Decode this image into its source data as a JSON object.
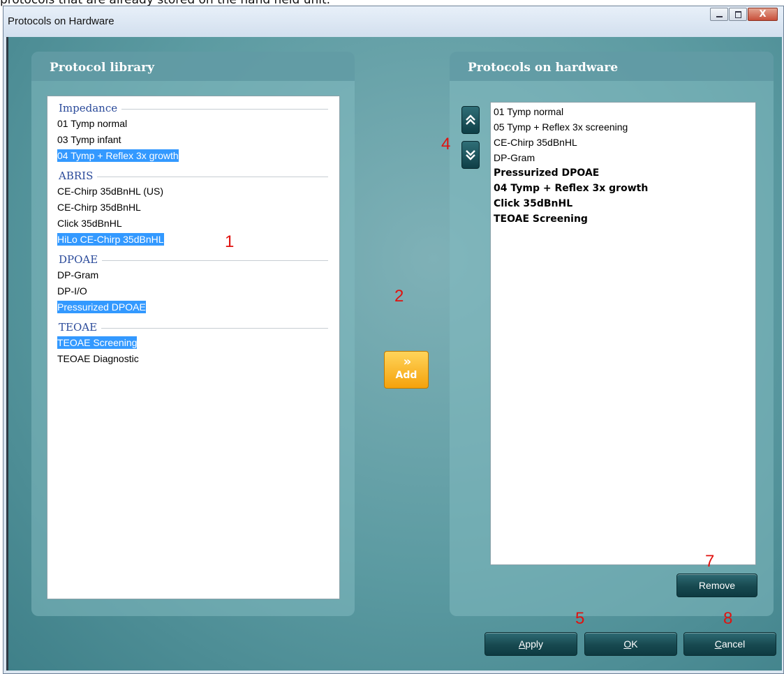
{
  "caption_text": "protocols that are already stored on the hand held unit.",
  "window": {
    "title": "Protocols on Hardware",
    "minimize_icon": "minimize-icon",
    "maximize_icon": "maximize-icon",
    "close_glyph": "X"
  },
  "library": {
    "title": "Protocol library",
    "groups": [
      {
        "label": "Impedance",
        "items": [
          "01 Tymp normal",
          "03 Tymp infant",
          "04 Tymp + Reflex 3x growth"
        ]
      },
      {
        "label": "ABRIS",
        "items": [
          "CE-Chirp 35dBnHL (US)",
          "CE-Chirp 35dBnHL",
          "Click 35dBnHL",
          "HiLo CE-Chirp 35dBnHL"
        ]
      },
      {
        "label": "DPOAE",
        "items": [
          "DP-Gram",
          "DP-I/O",
          "Pressurized DPOAE"
        ]
      },
      {
        "label": "TEOAE",
        "items": [
          "TEOAE Screening",
          "TEOAE Diagnostic"
        ]
      }
    ],
    "selected_items": [
      "04 Tymp + Reflex 3x growth",
      "HiLo CE-Chirp 35dBnHL",
      "Pressurized DPOAE",
      "TEOAE Screening"
    ]
  },
  "hardware": {
    "title": "Protocols on hardware",
    "items": [
      {
        "label": "01 Tymp normal",
        "bold": false
      },
      {
        "label": "05 Tymp + Reflex 3x screening",
        "bold": false
      },
      {
        "label": "CE-Chirp 35dBnHL",
        "bold": false
      },
      {
        "label": "DP-Gram",
        "bold": false
      },
      {
        "label": "Pressurized DPOAE",
        "bold": true
      },
      {
        "label": "04 Tymp + Reflex 3x growth",
        "bold": true
      },
      {
        "label": "Click 35dBnHL",
        "bold": true
      },
      {
        "label": "TEOAE Screening",
        "bold": true
      }
    ],
    "move_up_icon": "double-chevron-up-icon",
    "move_down_icon": "double-chevron-down-icon",
    "remove_label": "Remove"
  },
  "add_button": {
    "label": "Add",
    "chevron": "»"
  },
  "buttons": {
    "apply_underline": "A",
    "apply_rest": "pply",
    "ok_underline": "O",
    "ok_rest": "K",
    "cancel_underline": "C",
    "cancel_rest": "ancel"
  },
  "callouts": {
    "n1": "1",
    "n2": "2",
    "n4": "4",
    "n5": "5",
    "n7": "7",
    "n8": "8"
  },
  "colors": {
    "selection": "#3399ff",
    "group_label": "#2a4a9a",
    "add_button": "#f5a20c",
    "callout": "#e0120f"
  }
}
